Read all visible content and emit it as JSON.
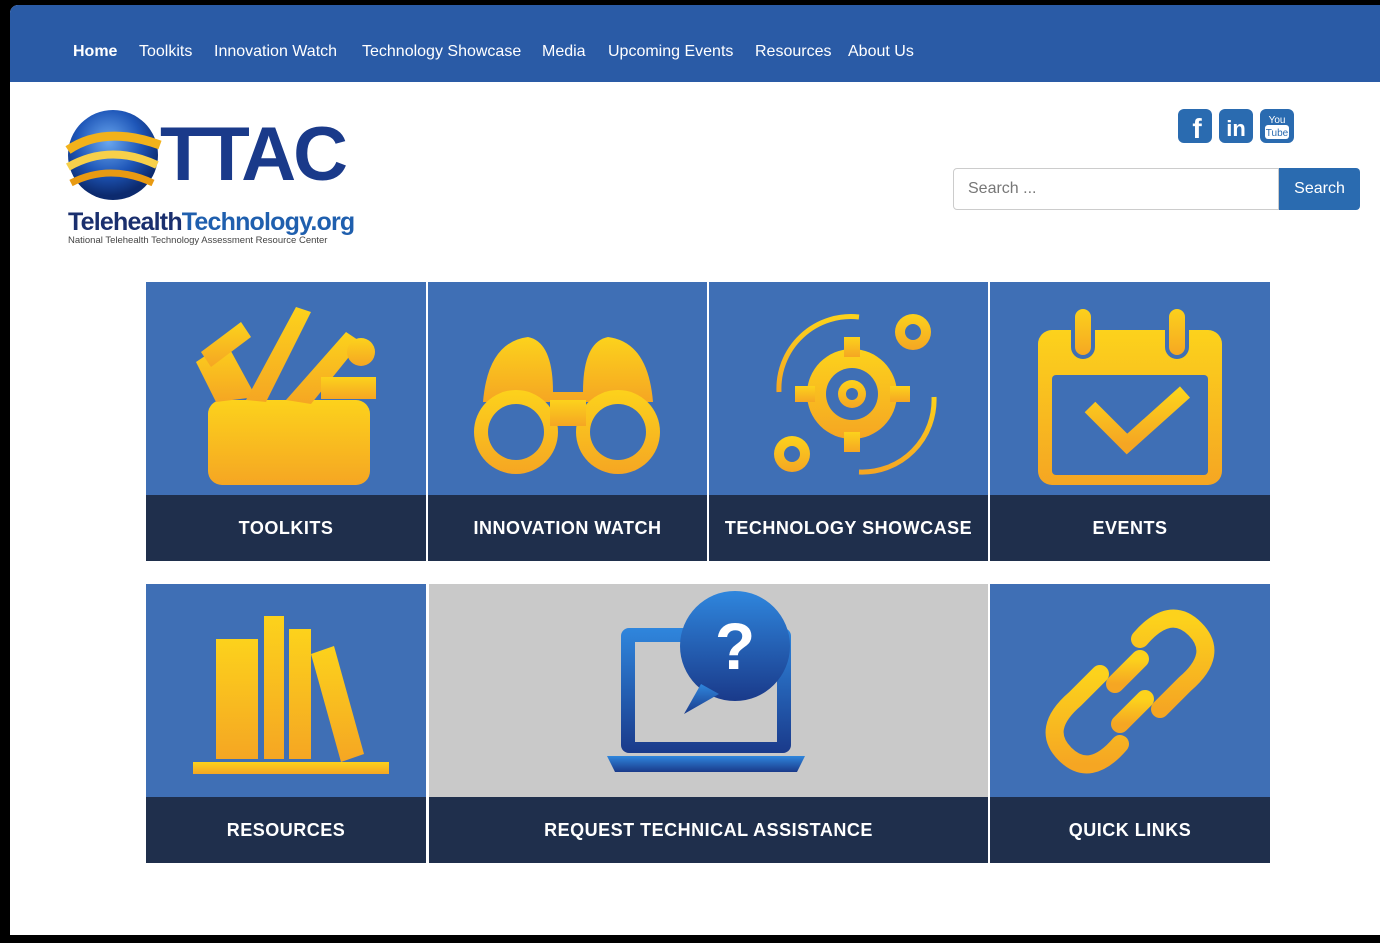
{
  "nav": {
    "items": [
      "Home",
      "Toolkits",
      "Innovation Watch",
      "Technology Showcase",
      "Media",
      "Upcoming Events",
      "Resources",
      "About Us"
    ],
    "active": "Home"
  },
  "logo": {
    "title": "TTAC",
    "domain_part1": "Telehealth",
    "domain_part2": "Technology.org",
    "tagline": "National Telehealth Technology Assessment Resource Center"
  },
  "social": [
    {
      "name": "facebook-icon",
      "glyph": "f"
    },
    {
      "name": "linkedin-icon",
      "glyph": "in"
    },
    {
      "name": "youtube-icon",
      "glyph_top": "You",
      "glyph_bottom": "Tube"
    }
  ],
  "search": {
    "placeholder": "Search ...",
    "button_label": "Search"
  },
  "tiles": [
    {
      "label": "TOOLKITS",
      "icon": "toolbox-icon"
    },
    {
      "label": "INNOVATION WATCH",
      "icon": "binoculars-icon"
    },
    {
      "label": "TECHNOLOGY SHOWCASE",
      "icon": "gears-icon"
    },
    {
      "label": "EVENTS",
      "icon": "calendar-check-icon"
    },
    {
      "label": "RESOURCES",
      "icon": "books-icon"
    },
    {
      "label": "REQUEST TECHNICAL ASSISTANCE",
      "icon": "laptop-question-icon"
    },
    {
      "label": "QUICK LINKS",
      "icon": "chain-link-icon"
    }
  ],
  "colors": {
    "nav_bg": "#2a5ba6",
    "tile_bg": "#3f6fb5",
    "tile_label_bg": "#1f2f4c",
    "icon_yellow": "#f9c21a",
    "icon_orange": "#f5a623",
    "search_button": "#2a6bb0"
  }
}
